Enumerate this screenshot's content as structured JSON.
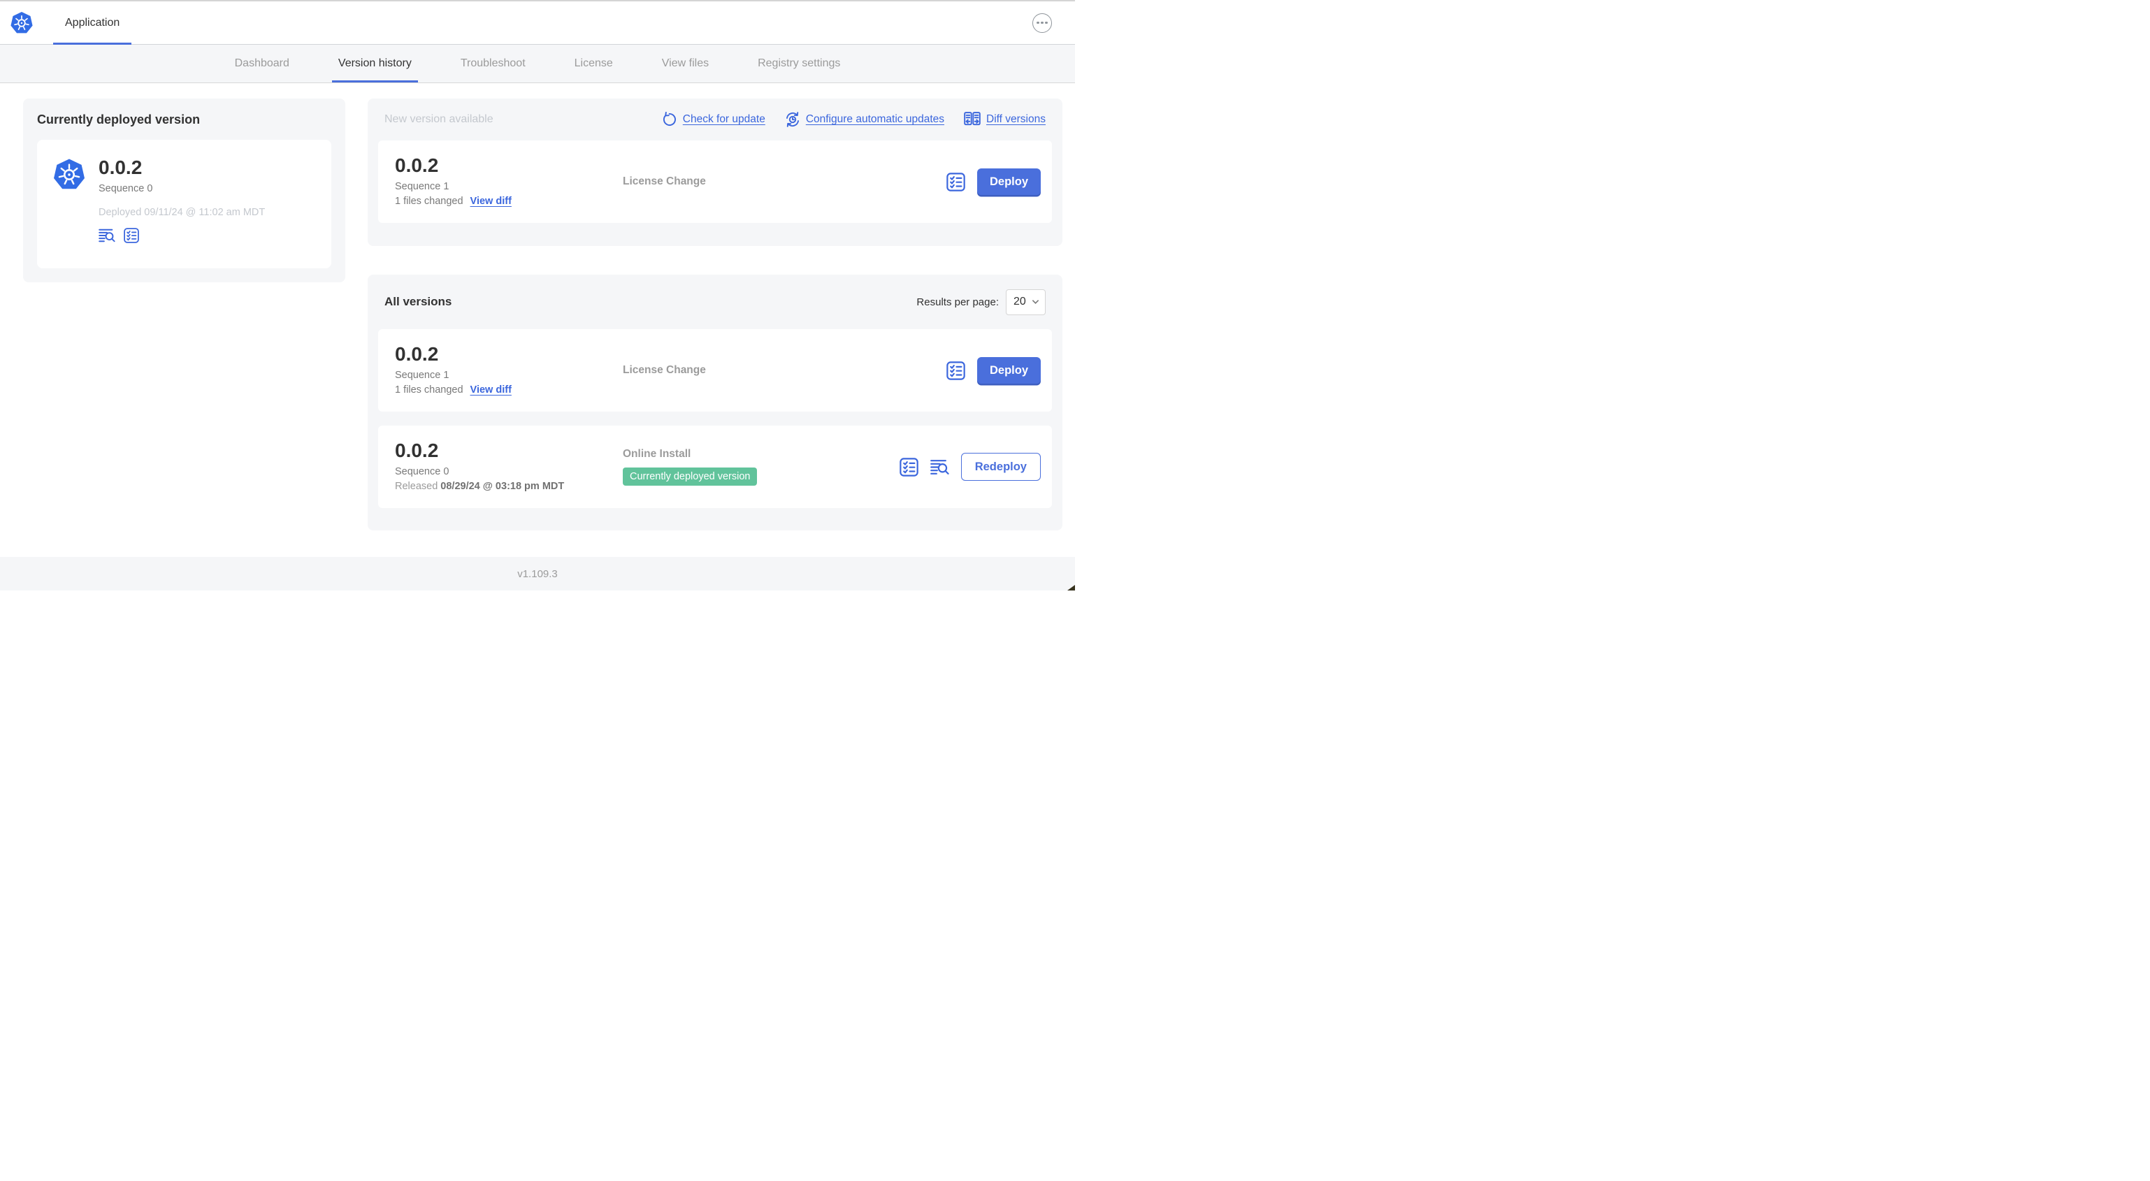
{
  "colors": {
    "k8s_blue": "#326CE5",
    "link_blue": "#3B66DD",
    "button_blue": "#4A6FDC",
    "active_tab_underline": "#4A6FDC",
    "badge_green": "#61C39B",
    "panel_gray": "#F5F6F8"
  },
  "header": {
    "app_tab_label": "Application",
    "more_menu_icon": "ellipsis-circle-icon",
    "logo_icon": "kubernetes-logo"
  },
  "nav": {
    "tabs": [
      {
        "label": "Dashboard",
        "active": false
      },
      {
        "label": "Version history",
        "active": true
      },
      {
        "label": "Troubleshoot",
        "active": false
      },
      {
        "label": "License",
        "active": false
      },
      {
        "label": "View files",
        "active": false
      },
      {
        "label": "Registry settings",
        "active": false
      }
    ]
  },
  "current_version": {
    "title": "Currently deployed version",
    "version": "0.0.2",
    "sequence": "Sequence 0",
    "deployed": "Deployed 09/11/24 @ 11:02 am MDT",
    "icons": [
      "logs-icon",
      "preflight-checklist-icon"
    ]
  },
  "new_version": {
    "title": "New version available",
    "check_for_update": "Check for update",
    "configure_automatic_updates": "Configure automatic updates",
    "diff_versions": "Diff versions",
    "row": {
      "version": "0.0.2",
      "sequence": "Sequence 1",
      "files_changed": "1 files changed",
      "view_diff": "View diff",
      "source": "License Change",
      "action_label": "Deploy"
    }
  },
  "all_versions": {
    "title": "All versions",
    "results_per_page_label": "Results per page:",
    "results_per_page_value": "20",
    "rows": [
      {
        "version": "0.0.2",
        "sequence": "Sequence 1",
        "files_changed": "1 files changed",
        "view_diff": "View diff",
        "source": "License Change",
        "action_label": "Deploy"
      },
      {
        "version": "0.0.2",
        "sequence": "Sequence 0",
        "released_label": "Released",
        "released_date": "08/29/24 @ 03:18 pm MDT",
        "source": "Online Install",
        "badge": "Currently deployed version",
        "action_label": "Redeploy"
      }
    ]
  },
  "footer": {
    "app_manager_version": "v1.109.3"
  }
}
